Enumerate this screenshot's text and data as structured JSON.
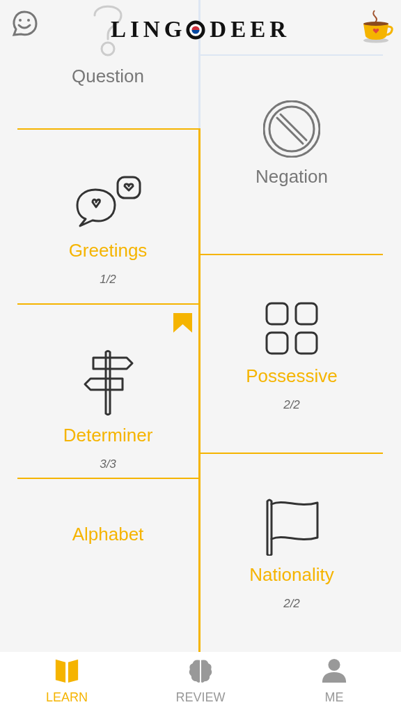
{
  "header": {
    "logo_start": "LING",
    "logo_end": "DEER"
  },
  "left_column": [
    {
      "title": "Question",
      "kind": "question",
      "locked": true,
      "bookmarked": false
    },
    {
      "title": "Greetings",
      "kind": "chat-hearts",
      "locked": false,
      "bookmarked": false,
      "progress": "1/2"
    },
    {
      "title": "Determiner",
      "kind": "signpost",
      "locked": false,
      "bookmarked": true,
      "progress": "3/3"
    },
    {
      "title": "Alphabet",
      "locked": false,
      "bookmarked": false
    }
  ],
  "right_column": [
    {
      "title": "Negation",
      "kind": "ban",
      "locked": true,
      "bookmarked": false
    },
    {
      "title": "Possessive",
      "kind": "grid",
      "locked": false,
      "bookmarked": false,
      "progress": "2/2"
    },
    {
      "title": "Nationality",
      "kind": "flag",
      "locked": false,
      "bookmarked": false,
      "progress": "2/2"
    }
  ],
  "tabs": [
    {
      "label": "LEARN",
      "kind": "book",
      "selected": true
    },
    {
      "label": "REVIEW",
      "kind": "brain",
      "selected": false
    },
    {
      "label": "ME",
      "kind": "person",
      "selected": false
    }
  ]
}
